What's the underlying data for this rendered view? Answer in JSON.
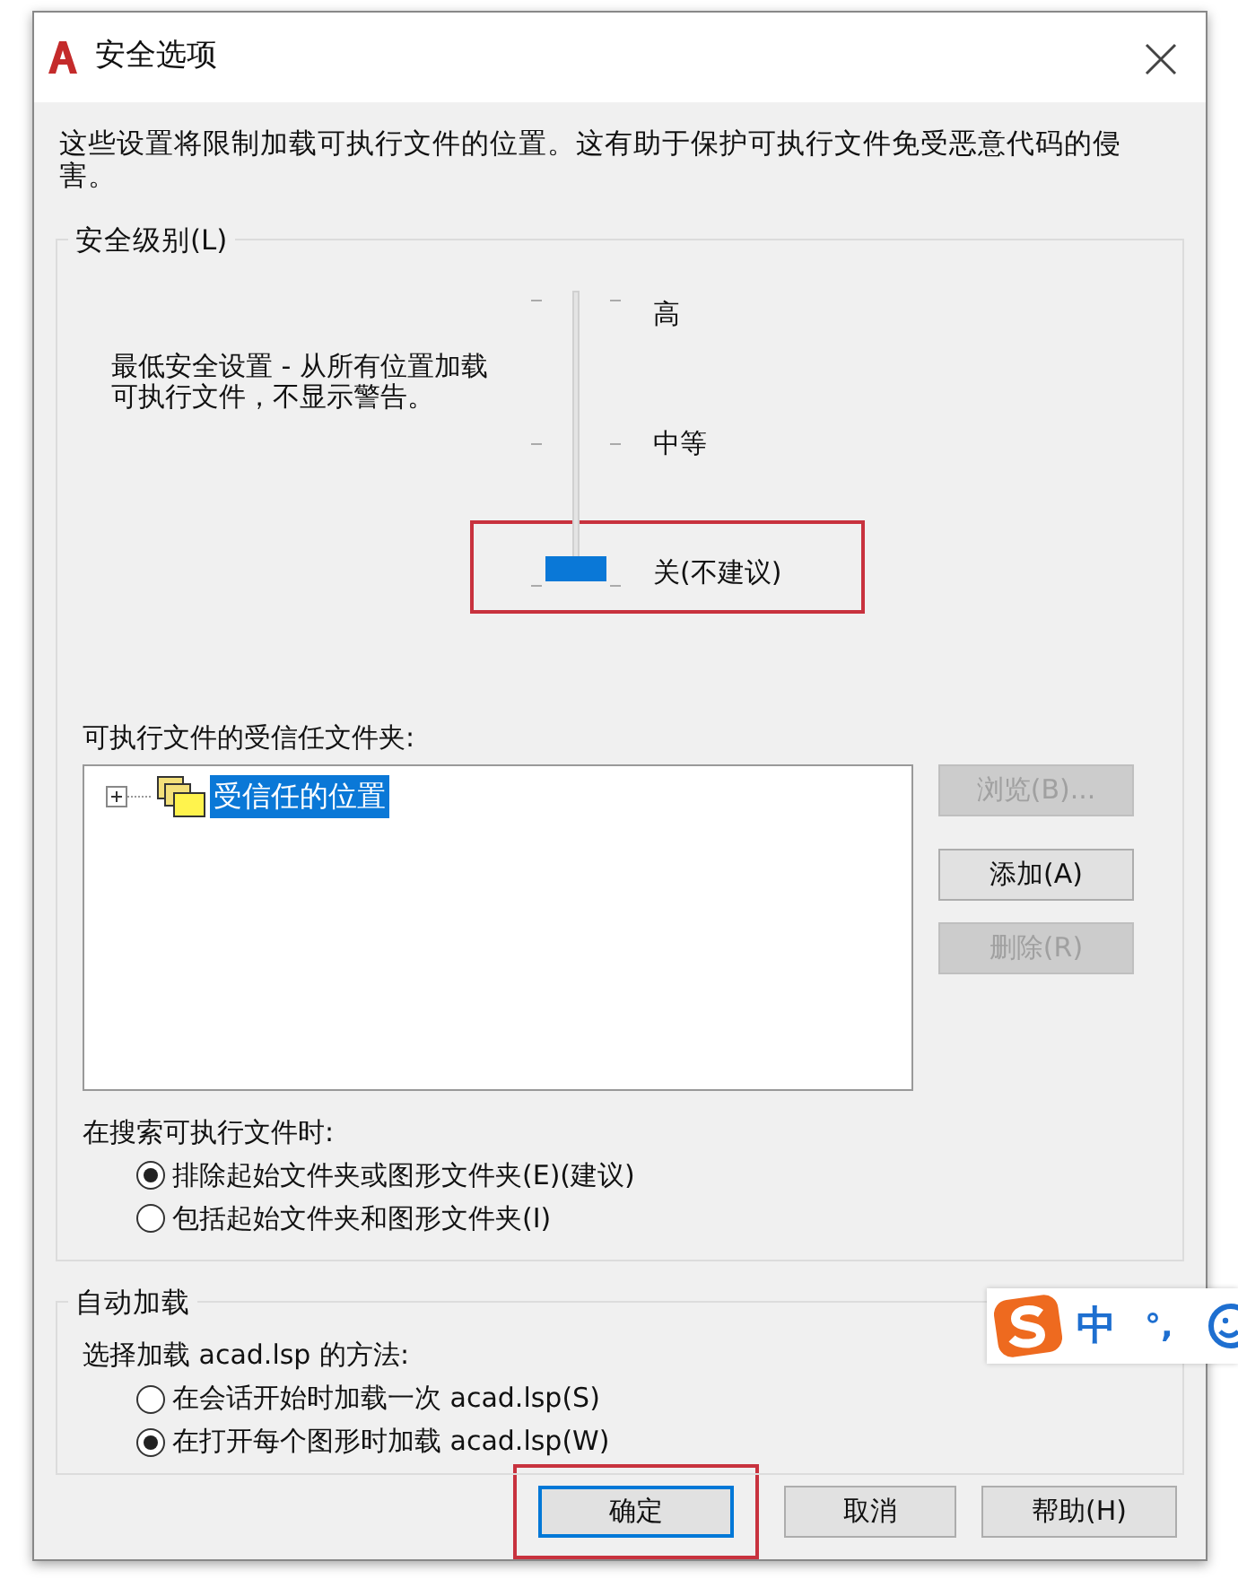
{
  "window": {
    "title": "安全选项"
  },
  "description": "这些设置将限制加载可执行文件的位置。这有助于保护可执行文件免受恶意代码的侵害。",
  "security_level": {
    "title": "安全级别(L)",
    "summary": "最低安全设置 - 从所有位置加载可执行文件，不显示警告。",
    "level": 0,
    "marks": [
      {
        "label": "高",
        "highlighted": false
      },
      {
        "label": "中等",
        "highlighted": false
      },
      {
        "label": "关(不建议)",
        "highlighted": true
      }
    ]
  },
  "trusted": {
    "label": "可执行文件的受信任文件夹:",
    "tree": [
      {
        "label": "受信任的位置",
        "selected": true,
        "expanded": false
      }
    ],
    "buttons": [
      {
        "label": "浏览(B)...",
        "disabled": true
      },
      {
        "label": "添加(A)",
        "disabled": false
      },
      {
        "label": "删除(R)",
        "disabled": true
      }
    ]
  },
  "search": {
    "label": "在搜索可执行文件时:",
    "options": [
      {
        "label": "排除起始文件夹或图形文件夹(E)(建议)",
        "selected": true
      },
      {
        "label": "包括起始文件夹和图形文件夹(I)",
        "selected": false
      }
    ]
  },
  "autoload": {
    "title": "自动加载",
    "label": "选择加载 acad.lsp 的方法:",
    "options": [
      {
        "label": "在会话开始时加载一次 acad.lsp(S)",
        "selected": false
      },
      {
        "label": "在打开每个图形时加载 acad.lsp(W)",
        "selected": true
      }
    ]
  },
  "buttons": [
    {
      "label": "确定",
      "default": true,
      "highlighted": true
    },
    {
      "label": "取消",
      "default": false,
      "highlighted": false
    },
    {
      "label": "帮助(H)",
      "default": false,
      "highlighted": false
    }
  ],
  "ime": {
    "lang": "中",
    "punct": "°,"
  }
}
